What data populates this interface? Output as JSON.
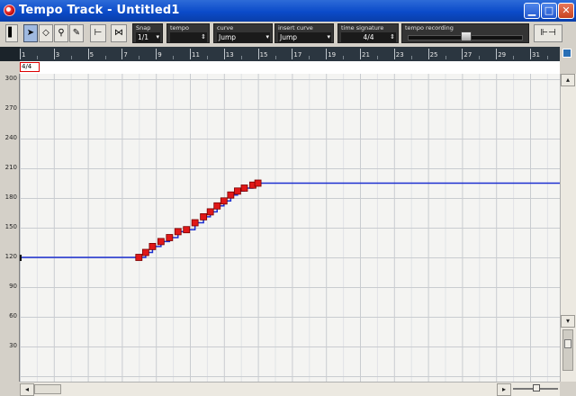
{
  "window": {
    "title": "Tempo Track - Untitled1",
    "controls": [
      "minimize-icon",
      "maximize-icon",
      "close-icon"
    ]
  },
  "toolbar": {
    "tools": [
      "info-icon",
      "arrow-tool-icon",
      "erase-tool-icon",
      "zoom-tool-icon",
      "pencil-tool-icon",
      "split-icon",
      "snap-icon"
    ],
    "snap": {
      "label": "Snap",
      "value": "1/1"
    },
    "tempo": {
      "label": "tempo",
      "value": ""
    },
    "curve": {
      "label": "curve",
      "value": "Jump"
    },
    "insert_curve": {
      "label": "insert curve",
      "value": "Jump"
    },
    "time_signature": {
      "label": "time signature",
      "value": "4/4"
    },
    "tempo_recording": {
      "label": "tempo recording",
      "level": 0.5
    }
  },
  "ruler": {
    "labels": [
      "1",
      "3",
      "5",
      "7",
      "9",
      "11",
      "13",
      "15",
      "17",
      "19",
      "21",
      "23",
      "25",
      "27",
      "29",
      "31"
    ]
  },
  "signature_lane": {
    "marker": "4/4"
  },
  "y_axis": {
    "labels": [
      "300",
      "270",
      "240",
      "210",
      "180",
      "150",
      "120",
      "90",
      "60",
      "30"
    ]
  },
  "colors": {
    "curve": "#1c2fd0",
    "point": "#e01818",
    "ruler_bg": "#2b3640",
    "title_bar": "#0b4bc9"
  },
  "chart_data": {
    "type": "line",
    "ylim": [
      0,
      300
    ],
    "xlim": [
      1,
      33
    ],
    "x_labels": [
      "1",
      "3",
      "5",
      "7",
      "9",
      "11",
      "13",
      "15",
      "17",
      "19",
      "21",
      "23",
      "25",
      "27",
      "29",
      "31"
    ],
    "y_labels": [
      "300",
      "270",
      "240",
      "210",
      "180",
      "150",
      "120",
      "90",
      "60",
      "30"
    ],
    "grid": true,
    "series": [
      {
        "points": [
          [
            1.0,
            120
          ],
          [
            8.0,
            120
          ],
          [
            8.4,
            125
          ],
          [
            8.8,
            131
          ],
          [
            9.3,
            136
          ],
          [
            9.8,
            140
          ],
          [
            10.3,
            146
          ],
          [
            10.8,
            148
          ],
          [
            11.3,
            155
          ],
          [
            11.8,
            161
          ],
          [
            12.2,
            166
          ],
          [
            12.6,
            172
          ],
          [
            13.0,
            177
          ],
          [
            13.4,
            183
          ],
          [
            13.8,
            187
          ],
          [
            14.2,
            190
          ],
          [
            14.7,
            193
          ],
          [
            15.0,
            195
          ],
          [
            33.0,
            195
          ]
        ],
        "editable_points": [
          [
            8.0,
            120
          ],
          [
            8.4,
            125
          ],
          [
            8.8,
            131
          ],
          [
            9.3,
            136
          ],
          [
            9.8,
            140
          ],
          [
            10.3,
            146
          ],
          [
            10.8,
            148
          ],
          [
            11.3,
            155
          ],
          [
            11.8,
            161
          ],
          [
            12.2,
            166
          ],
          [
            12.6,
            172
          ],
          [
            13.0,
            177
          ],
          [
            13.4,
            183
          ],
          [
            13.8,
            187
          ],
          [
            14.2,
            190
          ],
          [
            14.7,
            193
          ],
          [
            15.0,
            195
          ]
        ]
      }
    ]
  }
}
